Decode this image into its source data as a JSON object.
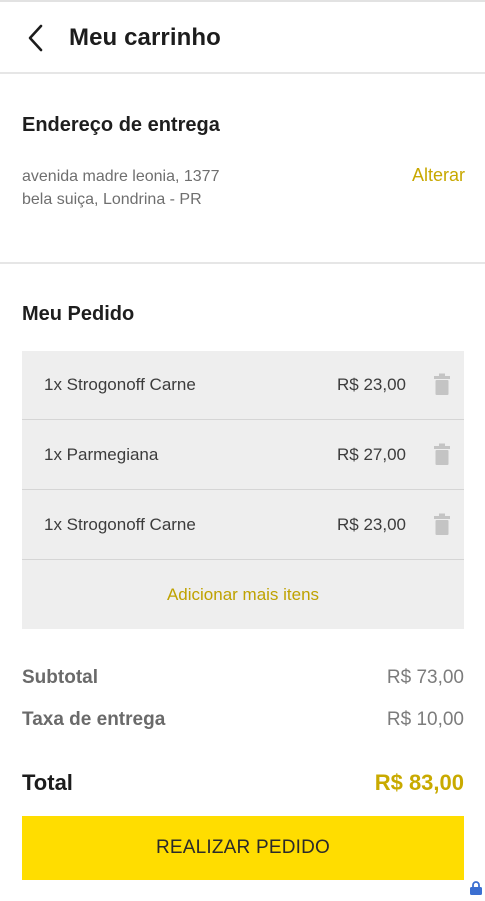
{
  "header": {
    "title": "Meu carrinho",
    "back_icon": "chevron-left-icon"
  },
  "delivery": {
    "heading": "Endereço de entrega",
    "address_line1": "avenida madre leonia, 1377",
    "address_line2": "bela suiça, Londrina - PR",
    "change_label": "Alterar"
  },
  "order": {
    "heading": "Meu Pedido",
    "items": [
      {
        "name": "1x Strogonoff Carne",
        "price": "R$ 23,00",
        "icon": "trash-icon"
      },
      {
        "name": "1x Parmegiana",
        "price": "R$ 27,00",
        "icon": "trash-icon"
      },
      {
        "name": "1x Strogonoff Carne",
        "price": "R$ 23,00",
        "icon": "trash-icon"
      }
    ],
    "add_more_label": "Adicionar mais itens"
  },
  "summary": {
    "subtotal_label": "Subtotal",
    "subtotal_value": "R$ 73,00",
    "delivery_fee_label": "Taxa de entrega",
    "delivery_fee_value": "R$ 10,00",
    "total_label": "Total",
    "total_value": "R$ 83,00"
  },
  "actions": {
    "submit_label": "REALIZAR PEDIDO"
  },
  "colors": {
    "accent": "#ffdd00",
    "accent_text": "#c9aa00",
    "order_background": "#eeeeee"
  }
}
